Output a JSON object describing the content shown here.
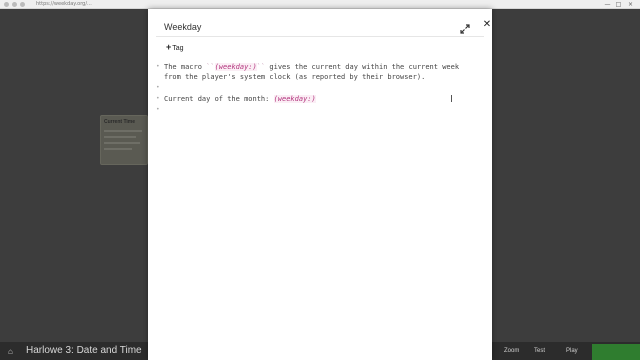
{
  "browser": {
    "address": "https://weekday.org/...",
    "controls": [
      "—",
      "□",
      "×"
    ]
  },
  "background": {
    "passage_title": "Current Time"
  },
  "taskbar": {
    "video_title": "Harlowe 3: Date and Time",
    "tools": [
      "Zoom",
      "Test",
      "Play"
    ]
  },
  "dialog": {
    "title": "Weekday",
    "tag_label": "Tag",
    "lines": [
      {
        "pre": "The macro ",
        "tick_open": "``",
        "macro": "(weekday:)",
        "tick_close": "``",
        "post": " gives the current day within the current week"
      },
      {
        "text": "from the player's system clock (as reported by their browser)."
      },
      {
        "text": ""
      },
      {
        "pre": "Current day of the month: ",
        "macro": "(weekday:)"
      },
      {
        "text": ""
      }
    ]
  }
}
